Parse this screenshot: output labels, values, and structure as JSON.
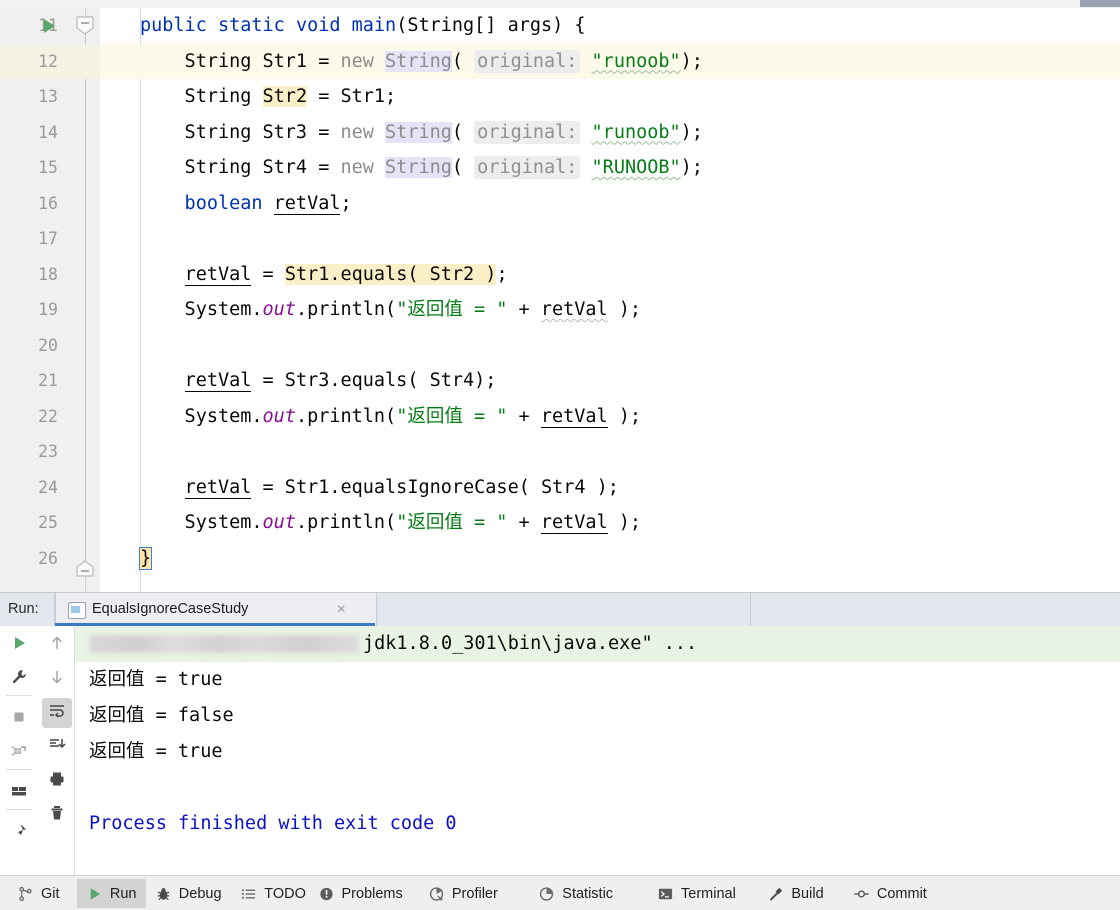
{
  "editor": {
    "lines": [
      {
        "no": "11",
        "indent": 0,
        "has_run_marker": true,
        "has_fold": true,
        "tokens": [
          {
            "t": "public ",
            "c": "kw"
          },
          {
            "t": "static ",
            "c": "kw"
          },
          {
            "t": "void ",
            "c": "kw"
          },
          {
            "t": "main",
            "c": "kw"
          },
          {
            "t": "(String[] args) {",
            "c": "ident"
          }
        ]
      },
      {
        "no": "12",
        "caret": true,
        "tokens": [
          {
            "t": "    String Str1 = ",
            "c": "ident"
          },
          {
            "t": "new ",
            "c": "cls"
          },
          {
            "t": "String",
            "c": "cls clsbg"
          },
          {
            "t": "( ",
            "c": "ident"
          },
          {
            "t": "original:",
            "c": "hint"
          },
          {
            "t": " ",
            "c": "ident"
          },
          {
            "t": "\"runoob\"",
            "c": "str wavy-g"
          },
          {
            "t": ");",
            "c": "ident"
          }
        ]
      },
      {
        "no": "13",
        "tokens": [
          {
            "t": "    String ",
            "c": "ident"
          },
          {
            "t": "Str2",
            "c": "ident hl"
          },
          {
            "t": " = Str1;",
            "c": "ident"
          }
        ]
      },
      {
        "no": "14",
        "tokens": [
          {
            "t": "    String Str3 = ",
            "c": "ident"
          },
          {
            "t": "new ",
            "c": "cls"
          },
          {
            "t": "String",
            "c": "cls clsbg"
          },
          {
            "t": "( ",
            "c": "ident"
          },
          {
            "t": "original:",
            "c": "hint"
          },
          {
            "t": " ",
            "c": "ident"
          },
          {
            "t": "\"runoob\"",
            "c": "str wavy-g"
          },
          {
            "t": ");",
            "c": "ident"
          }
        ]
      },
      {
        "no": "15",
        "tokens": [
          {
            "t": "    String Str4 = ",
            "c": "ident"
          },
          {
            "t": "new ",
            "c": "cls"
          },
          {
            "t": "String",
            "c": "cls clsbg"
          },
          {
            "t": "( ",
            "c": "ident"
          },
          {
            "t": "original:",
            "c": "hint"
          },
          {
            "t": " ",
            "c": "ident"
          },
          {
            "t": "\"RUNOOB\"",
            "c": "str wavy-g"
          },
          {
            "t": ");",
            "c": "ident"
          }
        ]
      },
      {
        "no": "16",
        "tokens": [
          {
            "t": "    boolean ",
            "c": "kw"
          },
          {
            "t": "retVal",
            "c": "ident uline"
          },
          {
            "t": ";",
            "c": "ident"
          }
        ]
      },
      {
        "no": "17",
        "tokens": []
      },
      {
        "no": "18",
        "tokens": [
          {
            "t": "    ",
            "c": "ident"
          },
          {
            "t": "retVal",
            "c": "ident uline"
          },
          {
            "t": " = ",
            "c": "ident"
          },
          {
            "t": "Str1.equals( Str2 )",
            "c": "ident hl"
          },
          {
            "t": ";",
            "c": "ident"
          }
        ]
      },
      {
        "no": "19",
        "tokens": [
          {
            "t": "    System.",
            "c": "ident"
          },
          {
            "t": "out",
            "c": "field"
          },
          {
            "t": ".println(",
            "c": "ident"
          },
          {
            "t": "\"返回值 = \"",
            "c": "str"
          },
          {
            "t": " + ",
            "c": "ident"
          },
          {
            "t": "retVal",
            "c": "ident wavy"
          },
          {
            "t": " );",
            "c": "ident"
          }
        ]
      },
      {
        "no": "20",
        "tokens": []
      },
      {
        "no": "21",
        "tokens": [
          {
            "t": "    ",
            "c": "ident"
          },
          {
            "t": "retVal",
            "c": "ident uline"
          },
          {
            "t": " = Str3.equals( Str4);",
            "c": "ident"
          }
        ]
      },
      {
        "no": "22",
        "tokens": [
          {
            "t": "    System.",
            "c": "ident"
          },
          {
            "t": "out",
            "c": "field"
          },
          {
            "t": ".println(",
            "c": "ident"
          },
          {
            "t": "\"返回值 = \"",
            "c": "str"
          },
          {
            "t": " + ",
            "c": "ident"
          },
          {
            "t": "retVal",
            "c": "ident uline"
          },
          {
            "t": " );",
            "c": "ident"
          }
        ]
      },
      {
        "no": "23",
        "tokens": []
      },
      {
        "no": "24",
        "tokens": [
          {
            "t": "    ",
            "c": "ident"
          },
          {
            "t": "retVal",
            "c": "ident uline"
          },
          {
            "t": " = Str1.equalsIgnoreCase( Str4 );",
            "c": "ident"
          }
        ]
      },
      {
        "no": "25",
        "tokens": [
          {
            "t": "    System.",
            "c": "ident"
          },
          {
            "t": "out",
            "c": "field"
          },
          {
            "t": ".println(",
            "c": "ident"
          },
          {
            "t": "\"返回值 = \"",
            "c": "str"
          },
          {
            "t": " + ",
            "c": "ident"
          },
          {
            "t": "retVal",
            "c": "ident uline"
          },
          {
            "t": " );",
            "c": "ident"
          }
        ]
      },
      {
        "no": "26",
        "has_fold_end": true,
        "tokens": [
          {
            "t": "}",
            "c": "ident brace-caret"
          }
        ]
      }
    ]
  },
  "run_panel": {
    "label": "Run:",
    "tab_name": "EqualsIgnoreCaseStudy",
    "tab_close": "×",
    "toolbar_left": [
      {
        "name": "rerun-button",
        "icon": "play"
      },
      {
        "name": "settings-button",
        "icon": "wrench"
      },
      {
        "name": "stop-button",
        "icon": "stop"
      },
      {
        "name": "rerun-failed-button",
        "icon": "bug-rerun"
      },
      {
        "name": "layout-button",
        "icon": "layout"
      },
      {
        "name": "pin-button",
        "icon": "pin"
      }
    ],
    "toolbar_right": [
      {
        "name": "up-button",
        "icon": "arrow-up"
      },
      {
        "name": "down-button",
        "icon": "arrow-down"
      },
      {
        "name": "soft-wrap-button",
        "icon": "soft-wrap",
        "active": true
      },
      {
        "name": "scroll-end-button",
        "icon": "scroll-end"
      },
      {
        "name": "print-button",
        "icon": "print"
      },
      {
        "name": "clear-all-button",
        "icon": "trash"
      }
    ],
    "console": {
      "command_line_suffix": "jdk1.8.0_301\\bin\\java.exe\" ...",
      "output": [
        "返回值 = true",
        "返回值 = false",
        "返回值 = true"
      ],
      "process_finished": "Process finished with exit code 0"
    }
  },
  "status_bar": {
    "items": [
      {
        "label": "Git",
        "icon": "branch",
        "active": false
      },
      {
        "label": "Run",
        "icon": "play",
        "active": true
      },
      {
        "label": "Debug",
        "icon": "bug",
        "active": false
      },
      {
        "label": "TODO",
        "icon": "list",
        "active": false
      },
      {
        "label": "Problems",
        "icon": "exclamation",
        "active": false
      },
      {
        "label": "Profiler",
        "icon": "profiler",
        "active": false
      },
      {
        "label": "Statistic",
        "icon": "pie",
        "active": false
      },
      {
        "label": "Terminal",
        "icon": "terminal",
        "active": false
      },
      {
        "label": "Build",
        "icon": "hammer",
        "active": false
      },
      {
        "label": "Commit",
        "icon": "commit",
        "active": false
      }
    ]
  },
  "colors": {
    "keyword": "#0033b3",
    "string": "#067d17",
    "class_ref": "#8c8c8c",
    "static_field": "#871094",
    "highlight_yellow": "#fbefc8",
    "caret_row": "#fdfaec",
    "run_green": "#59a869",
    "tab_underline": "#3c79c4",
    "process_blue": "#0b11c4"
  }
}
